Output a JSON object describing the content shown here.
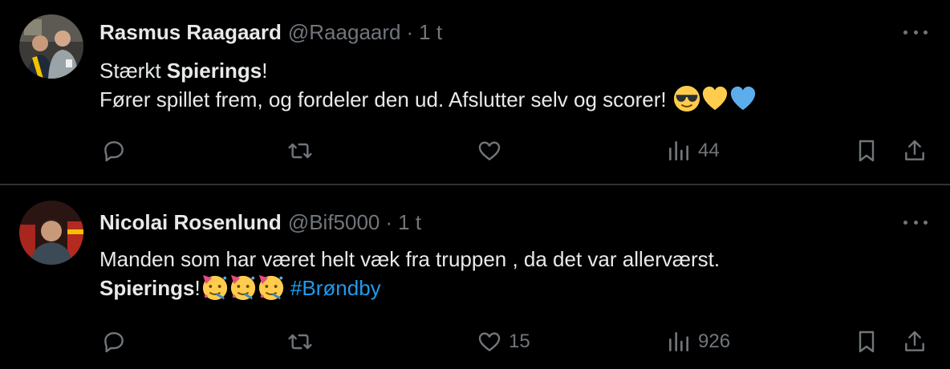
{
  "tweets": [
    {
      "author_name": "Rasmus Raagaard",
      "handle": "@Raagaard",
      "separator": "·",
      "time": "1 t",
      "lines": [
        {
          "before": "Stærkt ",
          "bold": "Spierings",
          "after": "!"
        },
        {
          "text": "Fører spillet frem, og fordeler den ud. Afslutter selv og scorer!"
        }
      ],
      "emojis": [
        "sunglasses-face",
        "yellow-heart",
        "blue-heart"
      ],
      "replies": "",
      "retweets": "",
      "likes": "",
      "views": "44"
    },
    {
      "author_name": "Nicolai Rosenlund",
      "handle": "@Bif5000",
      "separator": "·",
      "time": "1 t",
      "lines": [
        {
          "text": "Manden som har været helt væk fra truppen , da det var allerværst."
        },
        {
          "bold": "Spierings",
          "after": "!",
          "hashtag": "#Brøndby"
        }
      ],
      "emojis": [
        "partying-face",
        "partying-face",
        "partying-face"
      ],
      "replies": "",
      "retweets": "",
      "likes": "15",
      "views": "926"
    }
  ],
  "colors": {
    "background": "#000000",
    "text": "#e7e9ea",
    "muted": "#71767b",
    "divider": "#2f3336",
    "link": "#1d9bf0"
  },
  "icons": [
    "reply-icon",
    "retweet-icon",
    "like-icon",
    "views-icon",
    "bookmark-icon",
    "share-icon",
    "more-icon"
  ]
}
